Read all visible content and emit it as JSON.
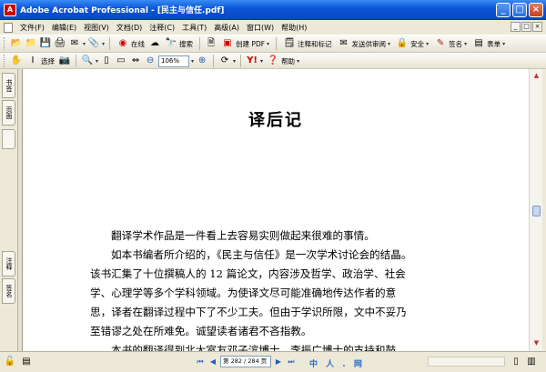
{
  "window": {
    "title": "Adobe Acrobat Professional - [民主与信任.pdf]",
    "buttons": [
      "_",
      "□",
      "×"
    ]
  },
  "menu": {
    "items": [
      "文件(F)",
      "编辑(E)",
      "视图(V)",
      "文档(D)",
      "注释(C)",
      "工具(T)",
      "高级(A)",
      "窗口(W)",
      "帮助(H)"
    ]
  },
  "toolbar1": {
    "online_label": "在线",
    "search_label": "搜索",
    "create_pdf_label": "创建 PDF",
    "review_label": "注释和标记",
    "send_review_label": "发送供审阅",
    "secure_label": "安全",
    "sign_label": "签名",
    "forms_label": "表单"
  },
  "toolbar2": {
    "select_label": "选择",
    "zoom_value": "106%",
    "help_label": "帮助"
  },
  "left_panel": {
    "tabs": [
      "书签",
      "页面",
      "注释",
      "签名"
    ]
  },
  "document": {
    "heading": "译后记",
    "paragraphs": [
      {
        "text": "翻译学术作品是一件看上去容易实则做起来很难的事情。",
        "indent": true
      },
      {
        "text": "如本书编者所介绍的，《民主与信任》是一次学术讨论会的结晶。",
        "indent": true
      },
      {
        "text": "该书汇集了十位撰稿人的 12 篇论文，内容涉及哲学、政治学、社会",
        "indent": false
      },
      {
        "text": "学、心理学等多个学科领域。为使译文尽可能准确地传达作者的意",
        "indent": false
      },
      {
        "text": "思，译者在翻译过程中下了不少工夫。但由于学识所限，文中不妥乃",
        "indent": false
      },
      {
        "text": "至错谬之处在所难免。诚望读者诸君不吝指教。",
        "indent": false
      },
      {
        "text": "本书的翻译得到北大室友邓子滨博士、李振广博士的支持和鼓",
        "indent": true
      }
    ]
  },
  "statusbar": {
    "page_indicator": "第 282 / 284 页",
    "watermark": "中 人 . 网"
  },
  "colors": {
    "titlebar": "#0b55d8",
    "chrome": "#ece9d8",
    "accent_red": "#c03020"
  }
}
